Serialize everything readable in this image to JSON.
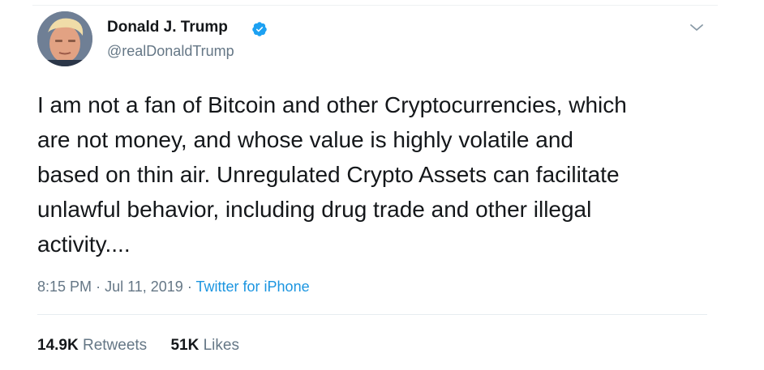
{
  "author": {
    "name": "Donald J. Trump",
    "handle": "@realDonaldTrump",
    "verified": true
  },
  "tweet": {
    "text": "I am not a fan of Bitcoin and other Cryptocurrencies, which\nare not money, and whose value is highly volatile and\nbased on thin air. Unregulated Crypto Assets can facilitate\nunlawful behavior, including drug trade and other illegal\nactivity....",
    "time": "8:15 PM",
    "separator": "·",
    "date": "Jul 11, 2019",
    "source": "Twitter for iPhone"
  },
  "stats": {
    "retweets_count": "14.9K",
    "retweets_label": "Retweets",
    "likes_count": "51K",
    "likes_label": "Likes"
  },
  "colors": {
    "text": "#14171a",
    "secondary": "#657786",
    "link": "#1b95e0",
    "verified": "#1da1f2"
  },
  "icons": {
    "verified": "verified-badge-icon",
    "menu": "chevron-down-icon"
  }
}
